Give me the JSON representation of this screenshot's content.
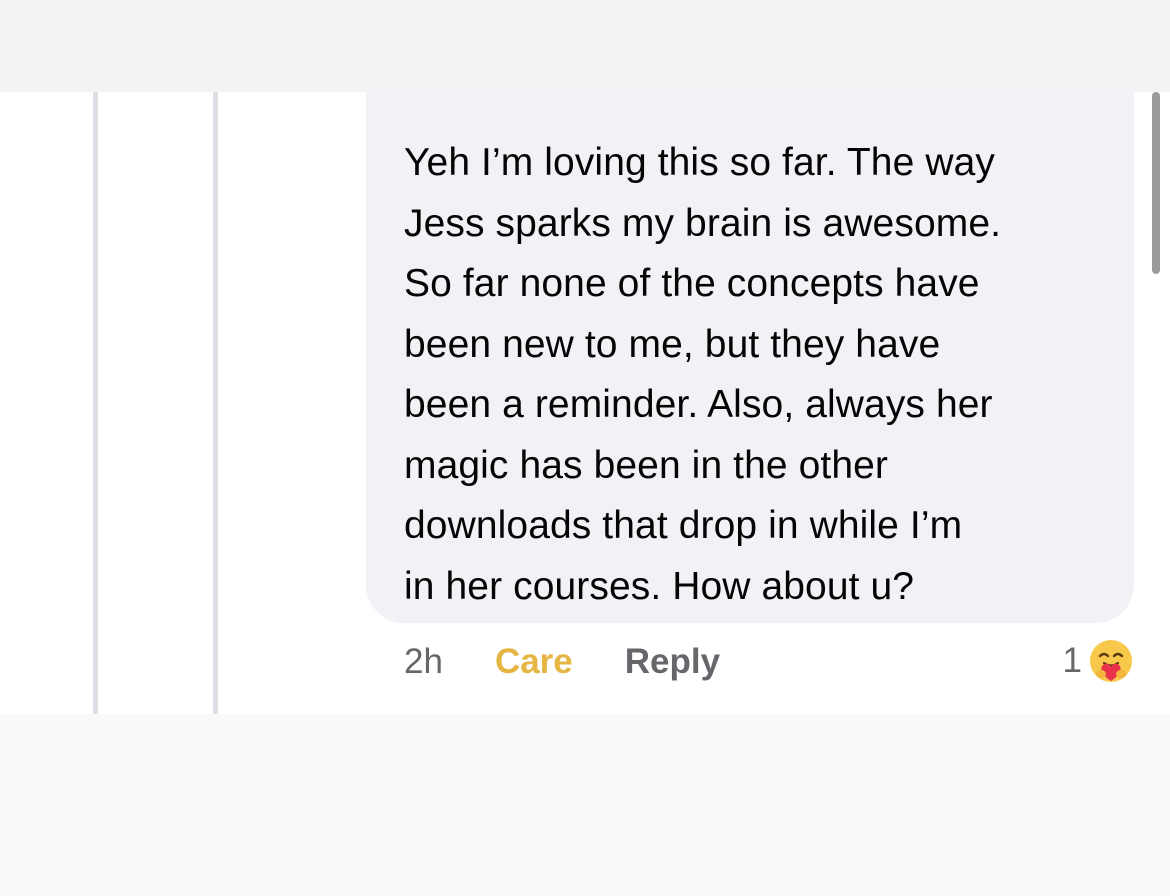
{
  "comment": {
    "text": "Yeh I’m loving this so far. The way\nJess sparks my brain is awesome.\nSo far none of the concepts have\nbeen new to me, but they have\nbeen a reminder. Also, always her\nmagic has been in the other\ndownloads that drop in while I’m\nin her courses. How about u?",
    "time": "2h",
    "reaction_label": "Care",
    "reply_label": "Reply",
    "reaction_count": "1",
    "reaction_icon": "care-emoji-icon"
  },
  "colors": {
    "care": "#e6b644",
    "bubble": "#f0f2f5",
    "meta_text": "#65676b"
  }
}
